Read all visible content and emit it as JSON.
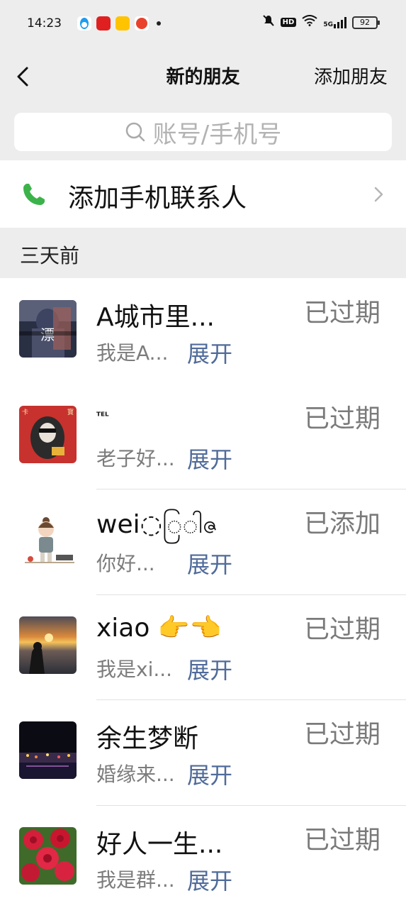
{
  "status_bar": {
    "time": "14:23",
    "hd": "HD",
    "signal": "5G",
    "battery": "92",
    "apps": [
      {
        "name": "qq-app-icon",
        "color": "#1d9bf0"
      },
      {
        "name": "tmall-app-icon",
        "color": "#e02020"
      },
      {
        "name": "meituan-app-icon",
        "color": "#ffc300"
      },
      {
        "name": "red-app-icon",
        "color": "#e9412c"
      }
    ]
  },
  "nav": {
    "title": "新的朋友",
    "action": "添加朋友"
  },
  "search": {
    "placeholder": "账号/手机号"
  },
  "add_contacts": {
    "label": "添加手机联系人",
    "icon_color": "#3cb34a"
  },
  "section": {
    "label": "三天前"
  },
  "friends": [
    {
      "name": "A城市里...",
      "message": "我是A...",
      "expand": "展开",
      "status": "已过期",
      "avatar": "avatar-dark-hood"
    },
    {
      "name": "ᵀᴱᴸ",
      "message": "老子好...",
      "expand": "展开",
      "status": "已过期",
      "avatar": "avatar-red-hoodie"
    },
    {
      "name": "wei◌ြ◌ါဇ",
      "message": "你好...",
      "expand": "展开",
      "status": "已添加",
      "avatar": "avatar-cartoon-girl"
    },
    {
      "name": "xiao 👉👈",
      "message": "我是xi...",
      "expand": "展开",
      "status": "已过期",
      "avatar": "avatar-sunset-girl"
    },
    {
      "name": "余生梦断",
      "message": "婚缘来...",
      "expand": "展开",
      "status": "已过期",
      "avatar": "avatar-night-city"
    },
    {
      "name": "好人一生...",
      "message": "我是群...",
      "expand": "展开",
      "status": "已过期",
      "avatar": "avatar-roses"
    }
  ],
  "colors": {
    "background_gray": "#ededed",
    "link_blue": "#506b9a",
    "phone_green": "#3cb34a"
  }
}
